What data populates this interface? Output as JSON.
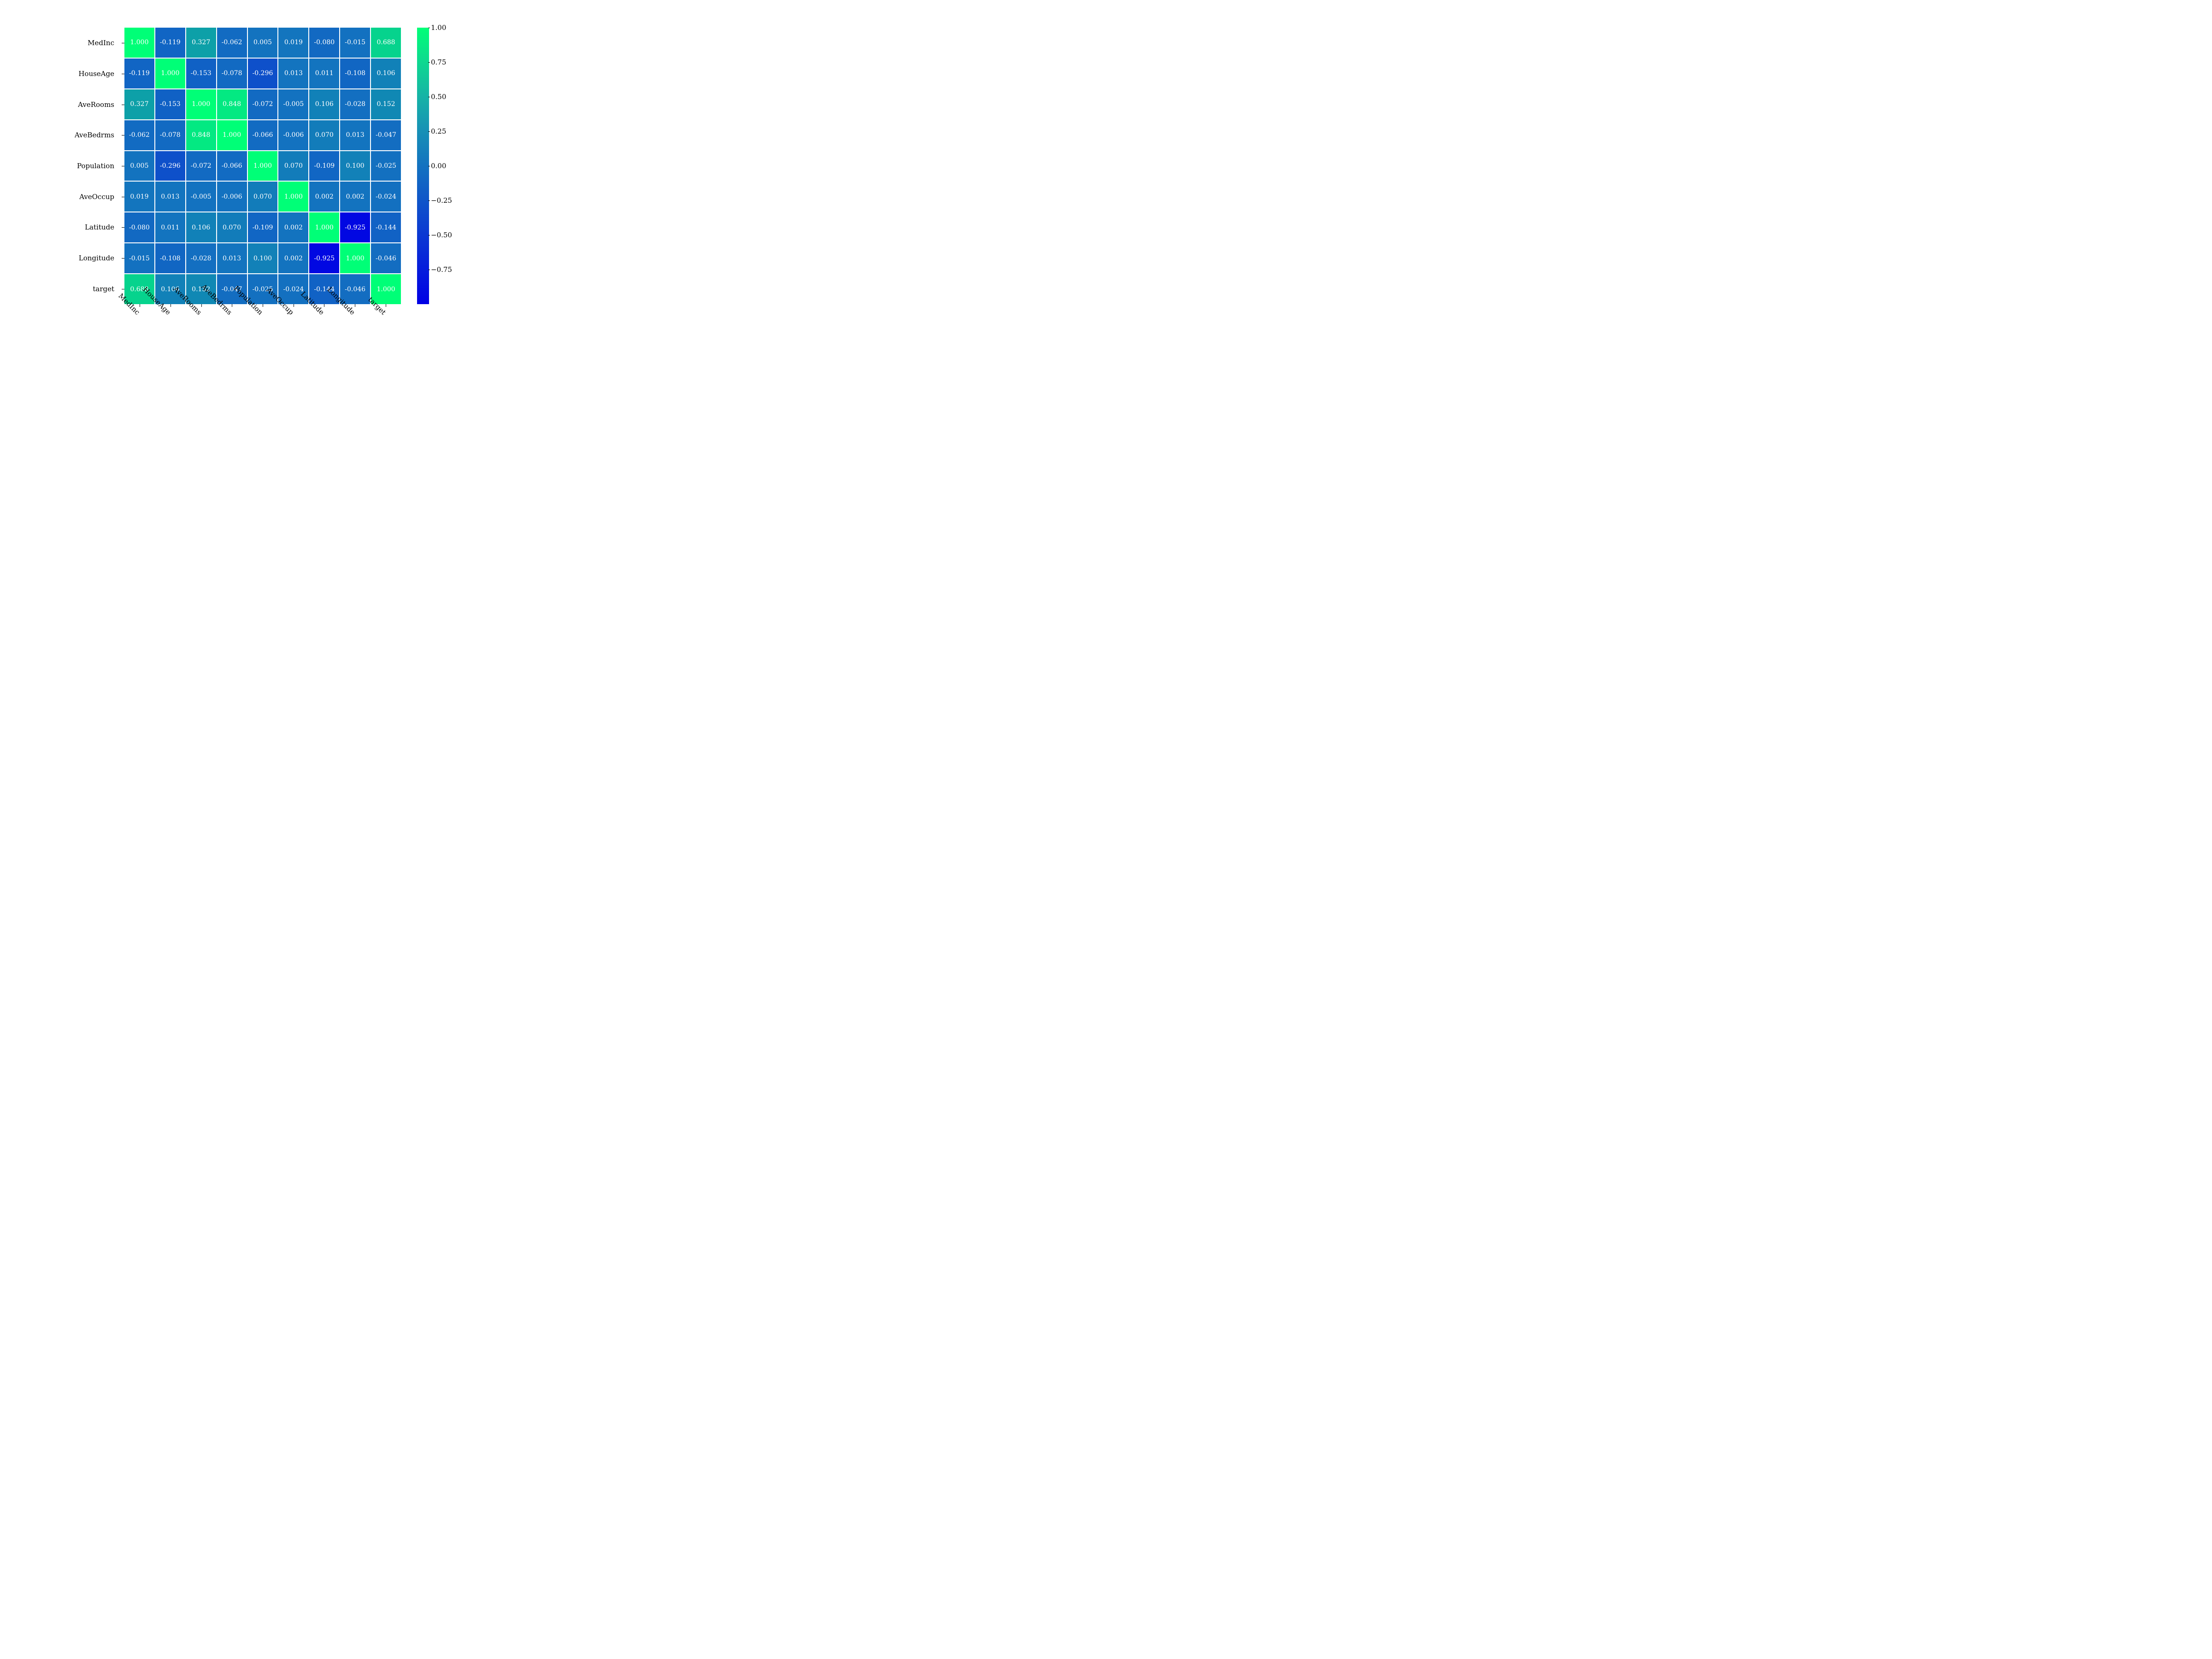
{
  "chart_data": {
    "type": "heatmap",
    "categories": [
      "MedInc",
      "HouseAge",
      "AveRooms",
      "AveBedrms",
      "Population",
      "AveOccup",
      "Latitude",
      "Longitude",
      "target"
    ],
    "matrix": [
      [
        1.0,
        -0.119,
        0.327,
        -0.062,
        0.005,
        0.019,
        -0.08,
        -0.015,
        0.688
      ],
      [
        -0.119,
        1.0,
        -0.153,
        -0.078,
        -0.296,
        0.013,
        0.011,
        -0.108,
        0.106
      ],
      [
        0.327,
        -0.153,
        1.0,
        0.848,
        -0.072,
        -0.005,
        0.106,
        -0.028,
        0.152
      ],
      [
        -0.062,
        -0.078,
        0.848,
        1.0,
        -0.066,
        -0.006,
        0.07,
        0.013,
        -0.047
      ],
      [
        0.005,
        -0.296,
        -0.072,
        -0.066,
        1.0,
        0.07,
        -0.109,
        0.1,
        -0.025
      ],
      [
        0.019,
        0.013,
        -0.005,
        -0.006,
        0.07,
        1.0,
        0.002,
        0.002,
        -0.024
      ],
      [
        -0.08,
        0.011,
        0.106,
        0.07,
        -0.109,
        0.002,
        1.0,
        -0.925,
        -0.144
      ],
      [
        -0.015,
        -0.108,
        -0.028,
        0.013,
        0.1,
        0.002,
        -0.925,
        1.0,
        -0.046
      ],
      [
        0.688,
        0.106,
        0.152,
        -0.047,
        -0.025,
        -0.024,
        -0.144,
        -0.046,
        1.0
      ]
    ],
    "vmin": -1.0,
    "vmax": 1.0,
    "colorbar_ticks": [
      1.0,
      0.75,
      0.5,
      0.25,
      0.0,
      -0.25,
      -0.5,
      -0.75
    ],
    "colorbar_tick_labels": [
      "1.00",
      "0.75",
      "0.50",
      "0.25",
      "0.00",
      "−0.25",
      "−0.50",
      "−0.75"
    ],
    "annot_fmt": "0.000"
  }
}
